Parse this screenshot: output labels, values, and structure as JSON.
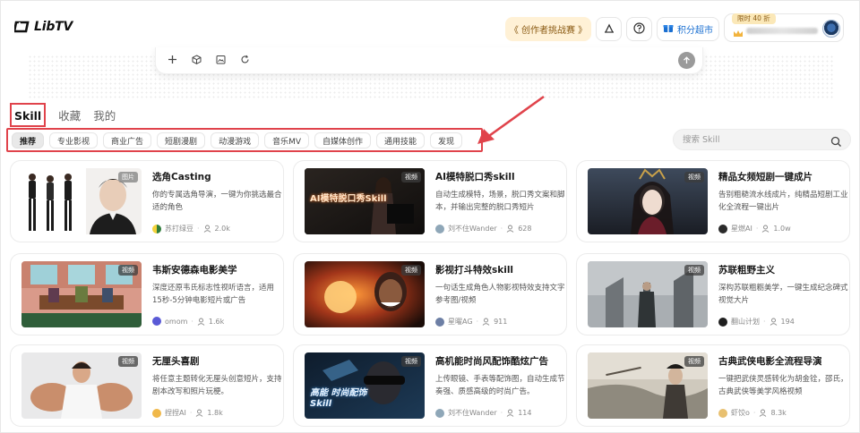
{
  "header": {
    "logo_text": "LibTV",
    "challenge_label": "《 创作者挑战赛 》",
    "points_label": "积分超市",
    "promo_badge": "限时 40 折"
  },
  "tabs": [
    {
      "label": "Skill",
      "active": true
    },
    {
      "label": "收藏",
      "active": false
    },
    {
      "label": "我的",
      "active": false
    }
  ],
  "categories": [
    "推荐",
    "专业影视",
    "商业广告",
    "短剧漫剧",
    "动漫游戏",
    "音乐MV",
    "自媒体创作",
    "通用技能",
    "发现"
  ],
  "search": {
    "placeholder": "搜索 Skill"
  },
  "colors": {
    "highlight": "#e0434b",
    "accent": "#1a6fd1",
    "challenge_bg": "#fff1d6"
  },
  "cards": [
    {
      "title": "选角Casting",
      "desc": "你的专属选角导演，一键为你挑选最合适的角色",
      "badge": "图片",
      "author": "苏打绿豆",
      "count": "2.0k"
    },
    {
      "title": "AI模特脱口秀skill",
      "desc": "自动生成模特，场景，脱口秀文案和脚本，并输出完整的脱口秀短片",
      "badge": "视频",
      "author": "刘不住Wander",
      "count": "628",
      "thumb_text": "AI模特脱口秀Skill"
    },
    {
      "title": "精品女频短剧一键成片",
      "desc": "告别粗糙流水线成片，纯精品短剧工业化全流程一键出片",
      "badge": "视频",
      "author": "星燃AI",
      "count": "1.0w"
    },
    {
      "title": "韦斯安德森电影美学",
      "desc": "深度还原韦氏标志性视听语言，适用15秒-5分钟电影短片或广告",
      "badge": "视频",
      "author": "omom",
      "count": "1.6k"
    },
    {
      "title": "影视打斗特效skill",
      "desc": "一句话生成角色人物影视特效支持文字参考图/视频",
      "badge": "视频",
      "author": "星曜AG",
      "count": "911"
    },
    {
      "title": "苏联粗野主义",
      "desc": "深构苏联粗粝美学，一键生成纪念碑式视觉大片",
      "badge": "视频",
      "author": "翻山计划",
      "count": "194"
    },
    {
      "title": "无厘头喜剧",
      "desc": "将任意主题转化无厘头创意短片，支持剧本改写和照片玩梗。",
      "badge": "视频",
      "author": "捏捏AI",
      "count": "1.8k"
    },
    {
      "title": "高机能时尚风配饰酷炫广告",
      "desc": "上传眼镜、手表等配饰图，自动生成节奏强、质感高级的时尚广告。",
      "badge": "视频",
      "author": "刘不住Wander",
      "count": "114",
      "thumb_text": "高能 时尚配饰Skill"
    },
    {
      "title": "古典武侠电影全流程导演",
      "desc": "一键把武侠灵感转化为胡金铨，邵氏，古典武侠等美学风格视频",
      "badge": "视频",
      "author": "虾饺o",
      "count": "8.3k"
    }
  ]
}
